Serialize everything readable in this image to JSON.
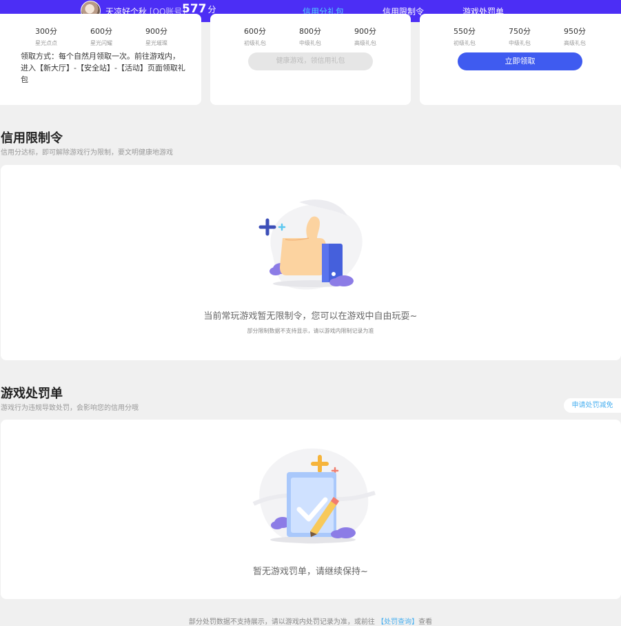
{
  "user": {
    "name": "天凉好个秋",
    "account_label": "[QQ账号]",
    "score": "577",
    "score_unit": "分"
  },
  "nav": {
    "tabs": [
      {
        "label": "信用分礼包"
      },
      {
        "label": "信用限制令"
      },
      {
        "label": "游戏处罚单"
      }
    ]
  },
  "packages": [
    {
      "tiers": [
        {
          "points": "300分",
          "label": "星光点点"
        },
        {
          "points": "600分",
          "label": "星光闪耀"
        },
        {
          "points": "900分",
          "label": "星光璀璨"
        }
      ],
      "howto": "领取方式：每个自然月领取一次。前往游戏内，进入【新大厅】-【安全站】-【活动】页面领取礼包"
    },
    {
      "tiers": [
        {
          "points": "600分",
          "label": "初级礼包"
        },
        {
          "points": "800分",
          "label": "中级礼包"
        },
        {
          "points": "900分",
          "label": "高级礼包"
        }
      ],
      "button": "健康游戏，领信用礼包"
    },
    {
      "tiers": [
        {
          "points": "550分",
          "label": "初级礼包"
        },
        {
          "points": "750分",
          "label": "中级礼包"
        },
        {
          "points": "950分",
          "label": "高级礼包"
        }
      ],
      "button": "立即领取"
    }
  ],
  "restriction": {
    "title": "信用限制令",
    "subtitle": "信用分达标，即可解除游戏行为限制，要文明健康地游戏",
    "empty_text": "当前常玩游戏暂无限制令，您可以在游戏中自由玩耍~",
    "empty_note": "部分限制数据不支持显示，请以游戏内限制记录为准"
  },
  "penalty": {
    "title": "游戏处罚单",
    "subtitle": "游戏行为违规导致处罚，会影响您的信用分哦",
    "appeal_button": "申请处罚减免",
    "empty_text": "暂无游戏罚单，请继续保持~",
    "footnote": "部分处罚数据不支持展示，请以游戏内处罚记录为准，或前往",
    "footnote_link": "【处罚查询】",
    "footnote_tail": "查看"
  },
  "colors": {
    "nav_bg": "#4c2ef5",
    "tab_active": "#52d3ff",
    "primary_button": "#3f5bf0",
    "link": "#4ab0f0"
  },
  "icons": {
    "restriction_empty": "thumbs-up-icon",
    "penalty_empty": "clipboard-check-icon"
  }
}
